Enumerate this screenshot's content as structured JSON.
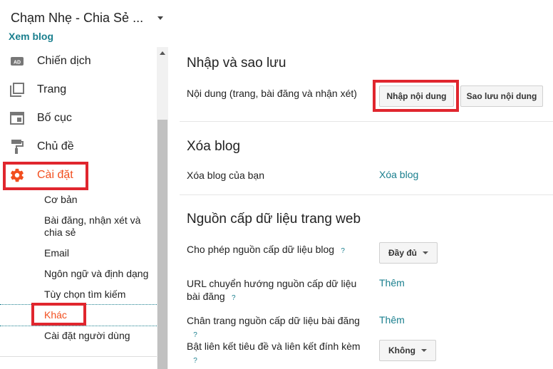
{
  "header": {
    "blog_title": "Chạm Nhẹ - Chia Sẻ ...",
    "view_blog": "Xem blog"
  },
  "sidebar": {
    "items": [
      {
        "label": "Chiến dịch",
        "icon": "ads-icon"
      },
      {
        "label": "Trang",
        "icon": "pages-icon"
      },
      {
        "label": "Bố cục",
        "icon": "layout-icon"
      },
      {
        "label": "Chủ đề",
        "icon": "paint-roller-icon"
      },
      {
        "label": "Cài đặt",
        "icon": "gear-icon"
      }
    ],
    "settings_sub": [
      {
        "label": "Cơ bản"
      },
      {
        "label": "Bài đăng, nhận xét và chia sẻ"
      },
      {
        "label": "Email"
      },
      {
        "label": "Ngôn ngữ và định dạng"
      },
      {
        "label": "Tùy chọn tìm kiếm"
      },
      {
        "label": "Khác"
      },
      {
        "label": "Cài đặt người dùng"
      }
    ]
  },
  "main": {
    "import_section": {
      "title": "Nhập và sao lưu",
      "row_label": "Nội dung (trang, bài đăng và nhận xét)",
      "import_button": "Nhập nội dung",
      "backup_button": "Sao lưu nội dung"
    },
    "delete_section": {
      "title": "Xóa blog",
      "row_label": "Xóa blog của bạn",
      "link": "Xóa blog"
    },
    "feed_section": {
      "title": "Nguồn cấp dữ liệu trang web",
      "help": "?",
      "rows": [
        {
          "label": "Cho phép nguồn cấp dữ liệu blog",
          "value": "Đầy đủ"
        },
        {
          "label": "URL chuyển hướng nguồn cấp dữ liệu bài đăng",
          "value": "Thêm"
        },
        {
          "label": "Chân trang nguồn cấp dữ liệu bài đăng",
          "value": "Thêm"
        },
        {
          "label": "Bật liên kết tiêu đề và liên kết đính kèm",
          "value": "Không"
        }
      ]
    }
  },
  "colors": {
    "accent": "#1a7f8e",
    "active": "#f24e1e",
    "highlight": "#e0262e"
  }
}
